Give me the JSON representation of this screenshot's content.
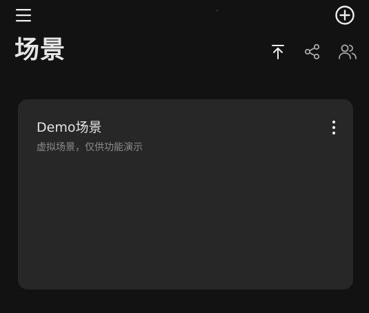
{
  "header": {
    "menu_icon": "menu-icon",
    "add_icon": "add-circle-icon",
    "title": "场景",
    "actions": [
      {
        "icon": "upload-icon"
      },
      {
        "icon": "share-icon"
      },
      {
        "icon": "users-icon"
      }
    ]
  },
  "scenes": [
    {
      "title": "Demo场景",
      "description": "虚拟场景，仅供功能演示",
      "more_icon": "more-vertical-icon"
    }
  ],
  "colors": {
    "background": "#121212",
    "card": "#272727",
    "text_primary": "#e4e4e4",
    "text_secondary": "#8c8c8c",
    "icon_primary": "#f0f0f0",
    "icon_secondary": "#a9a9a9"
  }
}
